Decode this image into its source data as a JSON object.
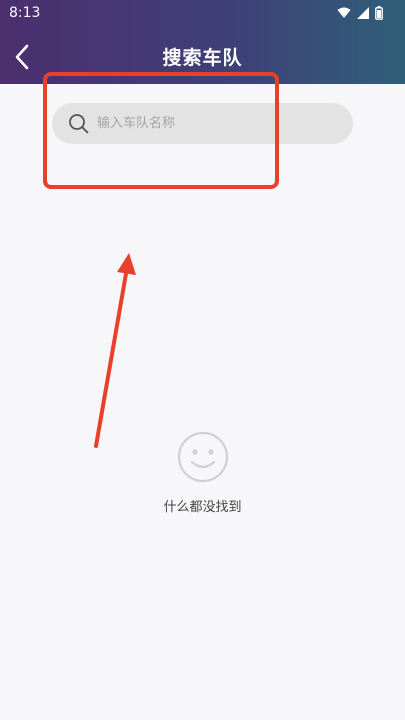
{
  "status_bar": {
    "time": "8:13",
    "icons": [
      "wifi-icon",
      "signal-icon",
      "battery-icon"
    ]
  },
  "header": {
    "title": "搜索车队",
    "back_icon": "chevron-left-icon"
  },
  "search": {
    "placeholder": "输入车队名称",
    "value": "",
    "icon": "search-icon"
  },
  "empty_state": {
    "icon": "smiley-icon",
    "message": "什么都没找到"
  },
  "colors": {
    "header_gradient_start": "#4b2f6e",
    "header_gradient_end": "#2f5f78",
    "annotation_red": "#e8402c",
    "search_bg": "#e3e3e3",
    "page_bg": "#f7f6f8"
  }
}
